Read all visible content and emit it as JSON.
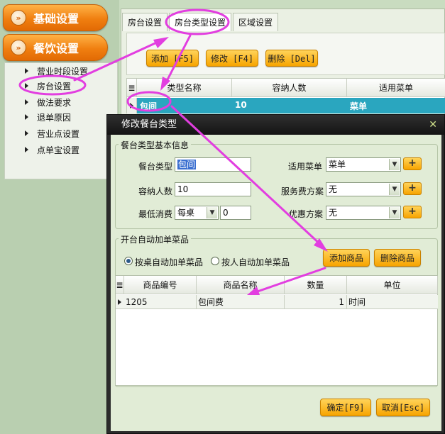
{
  "sidebar": {
    "sections": [
      {
        "label": "基础设置",
        "icon": "double-chevron-right-icon"
      },
      {
        "label": "餐饮设置",
        "icon": "double-chevron-right-icon"
      }
    ],
    "items": [
      {
        "label": "营业时段设置"
      },
      {
        "label": "房台设置"
      },
      {
        "label": "做法要求"
      },
      {
        "label": "退单原因"
      },
      {
        "label": "营业点设置"
      },
      {
        "label": "点单宝设置"
      }
    ]
  },
  "tabs": [
    {
      "label": "房台设置"
    },
    {
      "label": "房台类型设置"
    },
    {
      "label": "区域设置"
    }
  ],
  "toolbar": {
    "add_label": "添加 [F5]",
    "edit_label": "修改 [F4]",
    "delete_label": "删除 [Del]"
  },
  "table": {
    "columns": [
      "类型名称",
      "容纳人数",
      "适用菜单"
    ],
    "rows": [
      {
        "name": "包间",
        "capacity": "10",
        "menu": "菜单"
      }
    ]
  },
  "dialog": {
    "title": "修改餐台类型",
    "basic_group": "餐台类型基本信息",
    "fields": {
      "type_label": "餐台类型",
      "type_value": "包间",
      "capacity_label": "容纳人数",
      "capacity_value": "10",
      "min_label": "最低消费",
      "min_mode": "每桌",
      "min_value": "0",
      "menu_label": "适用菜单",
      "menu_value": "菜单",
      "service_label": "服务费方案",
      "service_value": "无",
      "discount_label": "优惠方案",
      "discount_value": "无",
      "plus": "+"
    },
    "auto_group": "开台自动加单菜品",
    "radio_table": "按桌自动加单菜品",
    "radio_person": "按人自动加单菜品",
    "add_item": "添加商品",
    "delete_item": "删除商品",
    "item_columns": [
      "商品编号",
      "商品名称",
      "数量",
      "单位"
    ],
    "items": [
      {
        "code": "1205",
        "name": "包间费",
        "qty": "1",
        "unit": "时间"
      }
    ],
    "ok": "确定[F9]",
    "cancel": "取消[Esc]",
    "close": "✕"
  },
  "colors": {
    "accent": "#f59a12",
    "selection": "#2aa6bf",
    "annotation": "#e040e0"
  }
}
